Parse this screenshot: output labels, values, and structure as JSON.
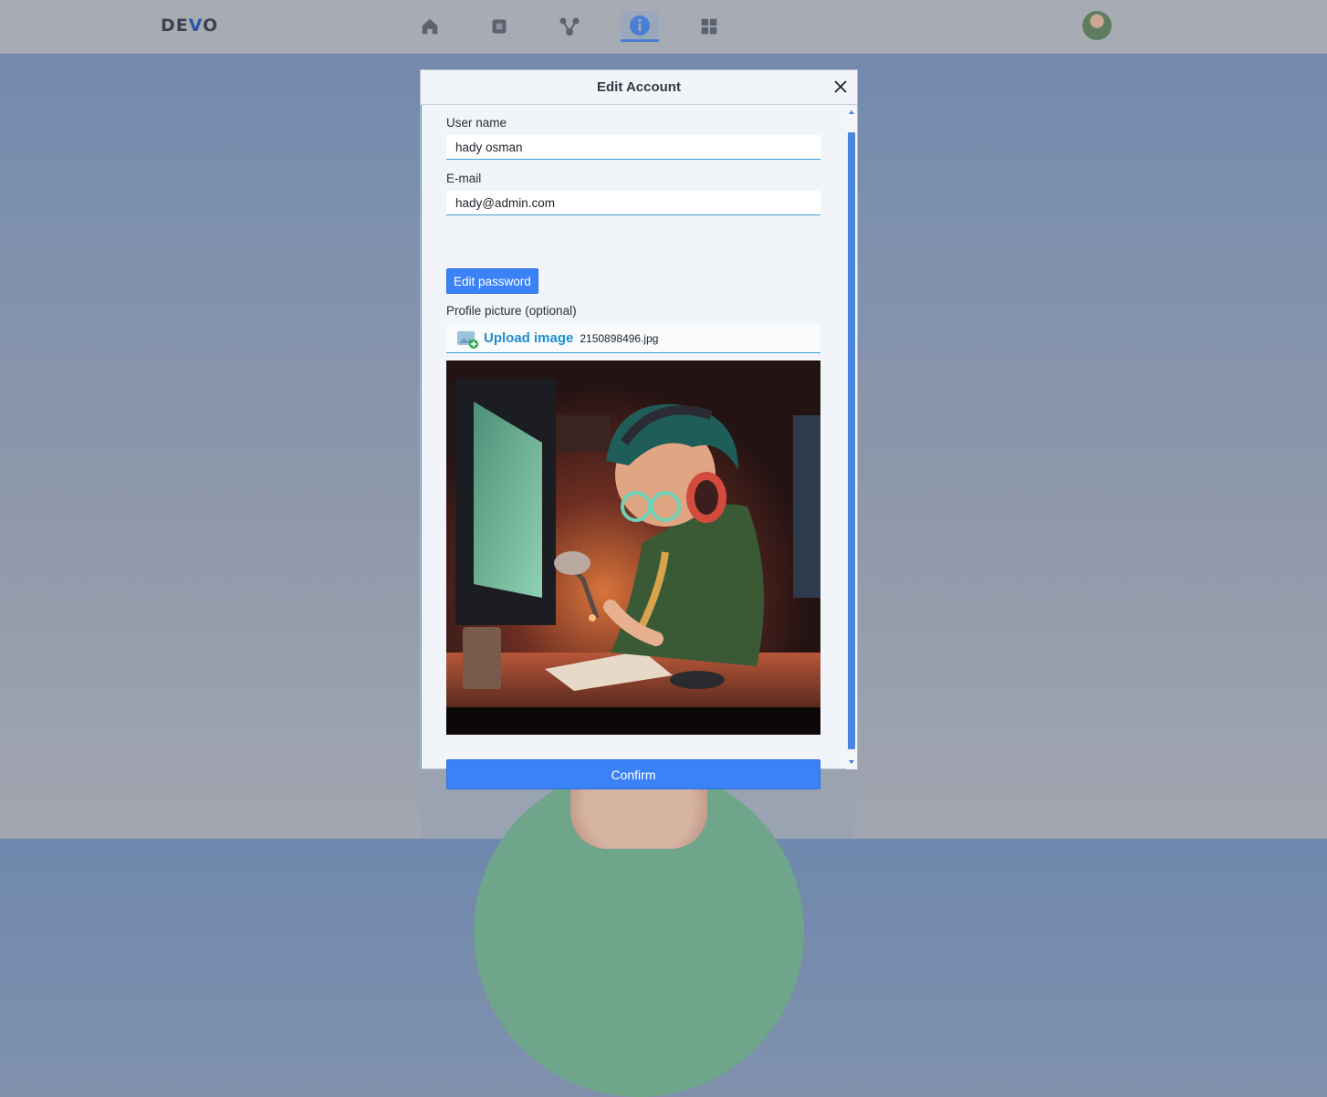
{
  "navbar": {
    "logo_left": "DE",
    "logo_accent": "V",
    "logo_right": "O",
    "icons": [
      "home-icon",
      "square-icon",
      "network-icon",
      "user-info-icon",
      "grid-icon"
    ],
    "active_index": 3
  },
  "modal": {
    "title": "Edit Account",
    "username_label": "User name",
    "username_value": "hady osman",
    "email_label": "E-mail",
    "email_value": "hady@admin.com",
    "edit_password_label": "Edit password",
    "profile_picture_label": "Profile picture (optional)",
    "upload_label": "Upload image",
    "file_name": "2150898496.jpg",
    "confirm_label": "Confirm"
  },
  "colors": {
    "accent": "#3b82f6",
    "link": "#1f8fd0",
    "input_border": "#3e9fd8"
  }
}
